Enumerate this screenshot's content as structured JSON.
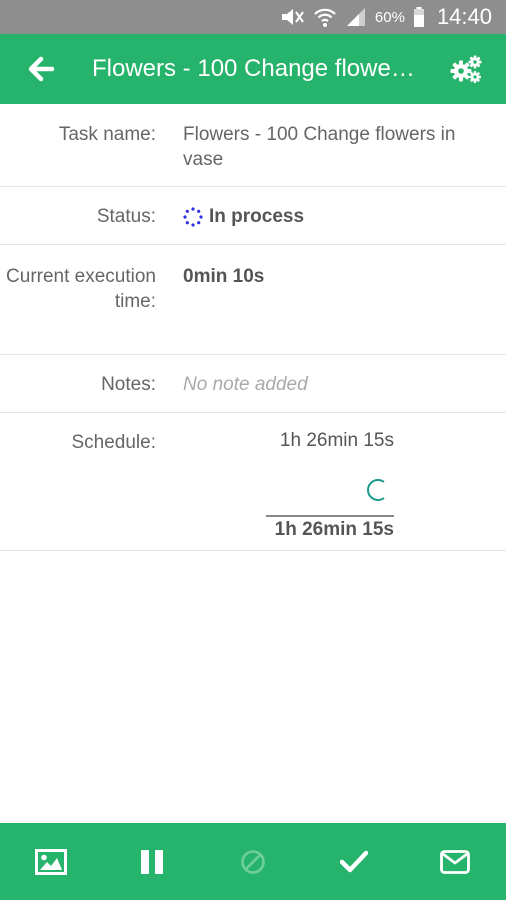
{
  "status_bar": {
    "battery_percent": "60%",
    "time": "14:40",
    "icons": [
      "mute-icon",
      "wifi-icon",
      "signal-icon",
      "battery-icon"
    ]
  },
  "app_bar": {
    "title": "Flowers - 100 Change flowe…",
    "back_icon": "back-arrow-icon",
    "settings_icon": "settings-gears-icon"
  },
  "details": {
    "task_name": {
      "label": "Task name:",
      "value": "Flowers - 100 Change flowers in vase"
    },
    "status": {
      "label": "Status:",
      "value": "In process",
      "icon": "in-process-spinner-icon"
    },
    "execution_time": {
      "label": "Current execution time:",
      "value": "0min 10s"
    },
    "notes": {
      "label": "Notes:",
      "value": "No note added"
    },
    "schedule": {
      "label": "Schedule:",
      "item_time": "1h 26min 15s",
      "total": "1h 26min 15s"
    }
  },
  "bottom_bar": {
    "buttons": [
      "image-icon",
      "pause-icon",
      "cancel-icon",
      "check-icon",
      "mail-icon"
    ]
  },
  "colors": {
    "primary": "#26b36b",
    "status_bar": "#8e8e8e",
    "spinner_blue": "#2f2fe6",
    "schedule_spinner": "#1a9a8a"
  }
}
